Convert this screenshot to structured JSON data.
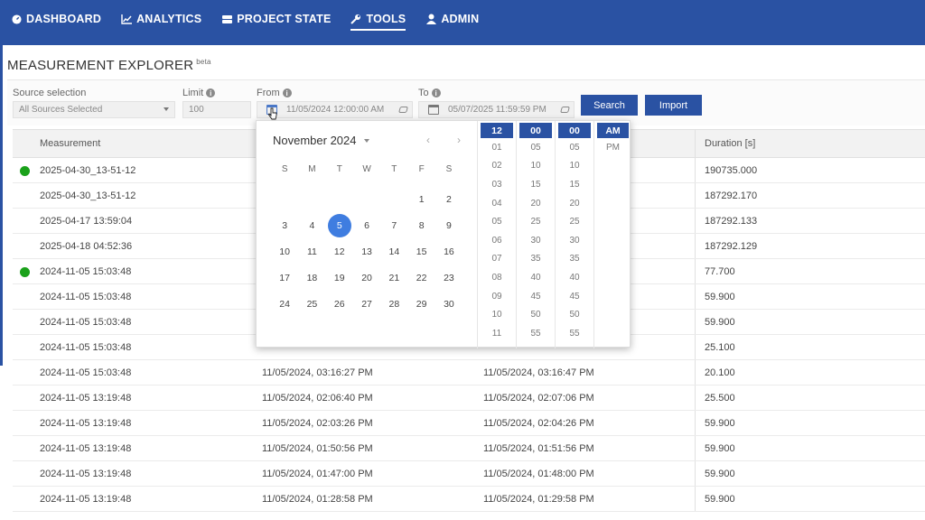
{
  "nav": {
    "items": [
      {
        "label": "DASHBOARD",
        "icon": "dashboard-icon"
      },
      {
        "label": "ANALYTICS",
        "icon": "chart-icon"
      },
      {
        "label": "PROJECT STATE",
        "icon": "database-icon"
      },
      {
        "label": "TOOLS",
        "icon": "wrench-icon",
        "active": true
      },
      {
        "label": "ADMIN",
        "icon": "user-icon"
      }
    ]
  },
  "page": {
    "title": "MEASUREMENT EXPLORER",
    "badge": "beta"
  },
  "filters": {
    "source_label": "Source selection",
    "source_value": "All Sources Selected",
    "limit_label": "Limit",
    "limit_value": "100",
    "from_label": "From",
    "from_value": "11/05/2024 12:00:00 AM",
    "to_label": "To",
    "to_value": "05/07/2025 11:59:59 PM",
    "search_label": "Search",
    "import_label": "Import"
  },
  "table": {
    "headers": [
      "Measurement",
      "",
      "",
      "Duration [s]"
    ],
    "rows": [
      {
        "name": "2025-04-30_13-51-12",
        "status": true,
        "start": "",
        "end": "",
        "duration": "190735.000"
      },
      {
        "name": "2025-04-30_13-51-12",
        "status": false,
        "start": "",
        "end": "",
        "duration": "187292.170"
      },
      {
        "name": "2025-04-17 13:59:04",
        "status": false,
        "start": "",
        "end": "",
        "duration": "187292.133"
      },
      {
        "name": "2025-04-18 04:52:36",
        "status": false,
        "start": "",
        "end": "",
        "duration": "187292.129"
      },
      {
        "name": "2024-11-05 15:03:48",
        "status": true,
        "start": "",
        "end": "",
        "duration": "77.700"
      },
      {
        "name": "2024-11-05 15:03:48",
        "status": false,
        "start": "",
        "end": "",
        "duration": "59.900"
      },
      {
        "name": "2024-11-05 15:03:48",
        "status": false,
        "start": "",
        "end": "",
        "duration": "59.900"
      },
      {
        "name": "2024-11-05 15:03:48",
        "status": false,
        "start": "",
        "end": "",
        "duration": "25.100"
      },
      {
        "name": "2024-11-05 15:03:48",
        "status": false,
        "start": "11/05/2024, 03:16:27 PM",
        "end": "11/05/2024, 03:16:47 PM",
        "duration": "20.100"
      },
      {
        "name": "2024-11-05 13:19:48",
        "status": false,
        "start": "11/05/2024, 02:06:40 PM",
        "end": "11/05/2024, 02:07:06 PM",
        "duration": "25.500"
      },
      {
        "name": "2024-11-05 13:19:48",
        "status": false,
        "start": "11/05/2024, 02:03:26 PM",
        "end": "11/05/2024, 02:04:26 PM",
        "duration": "59.900"
      },
      {
        "name": "2024-11-05 13:19:48",
        "status": false,
        "start": "11/05/2024, 01:50:56 PM",
        "end": "11/05/2024, 01:51:56 PM",
        "duration": "59.900"
      },
      {
        "name": "2024-11-05 13:19:48",
        "status": false,
        "start": "11/05/2024, 01:47:00 PM",
        "end": "11/05/2024, 01:48:00 PM",
        "duration": "59.900"
      },
      {
        "name": "2024-11-05 13:19:48",
        "status": false,
        "start": "11/05/2024, 01:28:58 PM",
        "end": "11/05/2024, 01:29:58 PM",
        "duration": "59.900"
      }
    ]
  },
  "picker": {
    "month_label": "November 2024",
    "prev": "‹",
    "next": "›",
    "weekdays": [
      "S",
      "M",
      "T",
      "W",
      "T",
      "F",
      "S"
    ],
    "days": [
      "",
      "",
      "",
      "",
      "",
      "1",
      "2",
      "3",
      "4",
      "5",
      "6",
      "7",
      "8",
      "9",
      "10",
      "11",
      "12",
      "13",
      "14",
      "15",
      "16",
      "17",
      "18",
      "19",
      "20",
      "21",
      "22",
      "23",
      "24",
      "25",
      "26",
      "27",
      "28",
      "29",
      "30"
    ],
    "selected_day": "5",
    "hours_header": "12",
    "hours": [
      "01",
      "02",
      "03",
      "04",
      "05",
      "06",
      "07",
      "08",
      "09",
      "10",
      "11"
    ],
    "minutes_header": "00",
    "minutes": [
      "05",
      "10",
      "15",
      "20",
      "25",
      "30",
      "35",
      "40",
      "45",
      "50",
      "55"
    ],
    "seconds_header": "00",
    "seconds": [
      "05",
      "10",
      "15",
      "20",
      "25",
      "30",
      "35",
      "40",
      "45",
      "50",
      "55"
    ],
    "ampm_header": "AM",
    "ampm": [
      "PM"
    ]
  },
  "colors": {
    "brand": "#2a52a3",
    "selected_day": "#3f7de0",
    "status_green": "#1aa11a"
  }
}
